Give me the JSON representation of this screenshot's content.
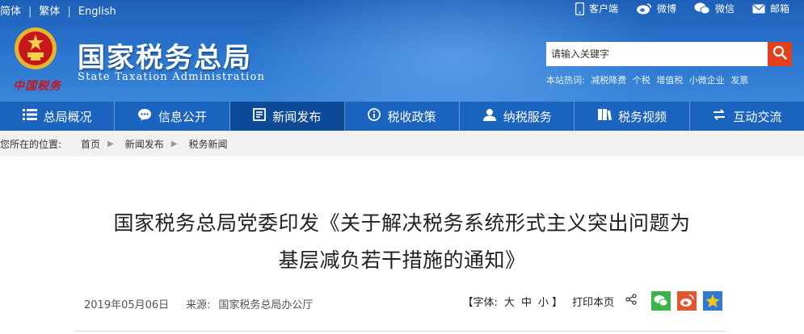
{
  "lang": [
    "简体",
    "繁体",
    "English"
  ],
  "toplinks": [
    {
      "icon": "mobile-icon",
      "label": "客户端"
    },
    {
      "icon": "weibo-icon",
      "label": "微博"
    },
    {
      "icon": "wechat-icon",
      "label": "微信"
    },
    {
      "icon": "mail-icon",
      "label": "邮箱"
    }
  ],
  "brand": {
    "name_cn": "国家税务总局",
    "name_en": "State Taxation Administration",
    "seal_text": "中国税务"
  },
  "search": {
    "placeholder": "请输入关键字",
    "hot_label": "本站热词:",
    "hot_words": [
      "减税降费",
      "个税",
      "增值税",
      "小微企业",
      "发票"
    ]
  },
  "nav": [
    {
      "icon": "menu-icon",
      "label": "总局概况",
      "active": false
    },
    {
      "icon": "chat-icon",
      "label": "信息公开",
      "active": false
    },
    {
      "icon": "news-icon",
      "label": "新闻发布",
      "active": true
    },
    {
      "icon": "info-icon",
      "label": "税收政策",
      "active": false
    },
    {
      "icon": "person-icon",
      "label": "纳税服务",
      "active": false
    },
    {
      "icon": "video-icon",
      "label": "税务视频",
      "active": false
    },
    {
      "icon": "exchange-icon",
      "label": "互动交流",
      "active": false
    }
  ],
  "breadcrumb": {
    "prefix": "您所在的位置:",
    "items": [
      "首页",
      "新闻发布",
      "税务新闻"
    ]
  },
  "article": {
    "title_line1": "国家税务总局党委印发《关于解决税务系统形式主义突出问题为",
    "title_line2": "基层减负若干措施的通知》",
    "date": "2019年05月06日",
    "source_label": "来源:",
    "source": "国家税务总局办公厅"
  },
  "tools": {
    "font_label": "【字体:",
    "sizes": [
      "大",
      "中",
      "小"
    ],
    "font_end": "】",
    "print_label": "打印本页"
  },
  "colors": {
    "header_blue": "#2b76cf",
    "nav_blue": "#1a64c0",
    "nav_active": "#0d4a97",
    "search_btn": "#e2401d"
  }
}
